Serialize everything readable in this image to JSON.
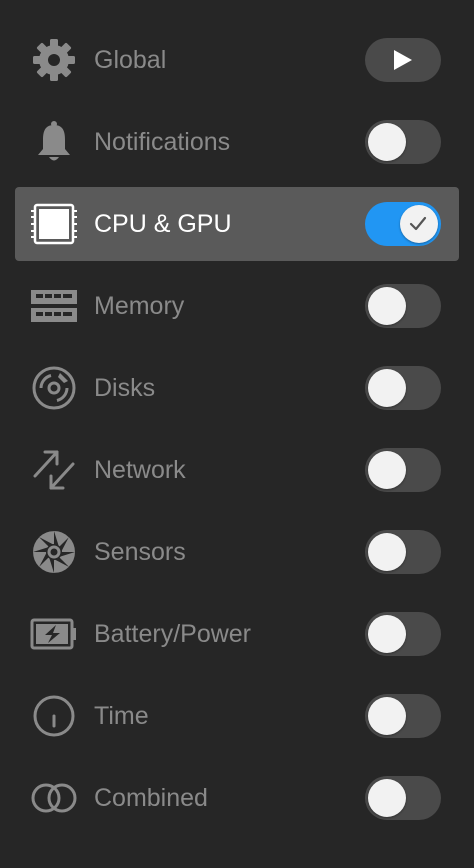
{
  "menu": {
    "items": [
      {
        "label": "Global",
        "icon": "gear-icon",
        "control": "play"
      },
      {
        "label": "Notifications",
        "icon": "bell-icon",
        "control": "toggle",
        "enabled": false
      },
      {
        "label": "CPU & GPU",
        "icon": "chip-icon",
        "control": "toggle",
        "enabled": true,
        "selected": true
      },
      {
        "label": "Memory",
        "icon": "memory-icon",
        "control": "toggle",
        "enabled": false
      },
      {
        "label": "Disks",
        "icon": "disk-icon",
        "control": "toggle",
        "enabled": false
      },
      {
        "label": "Network",
        "icon": "network-arrows-icon",
        "control": "toggle",
        "enabled": false
      },
      {
        "label": "Sensors",
        "icon": "fan-icon",
        "control": "toggle",
        "enabled": false
      },
      {
        "label": "Battery/Power",
        "icon": "battery-icon",
        "control": "toggle",
        "enabled": false
      },
      {
        "label": "Time",
        "icon": "clock-icon",
        "control": "toggle",
        "enabled": false
      },
      {
        "label": "Combined",
        "icon": "combined-rings-icon",
        "control": "toggle",
        "enabled": false
      }
    ]
  },
  "colors": {
    "background": "#262626",
    "selected_row": "#5a5a5a",
    "accent": "#2196f3",
    "icon": "#8a8a8a",
    "text_muted": "#8a8a8a",
    "text_selected": "#ffffff"
  }
}
